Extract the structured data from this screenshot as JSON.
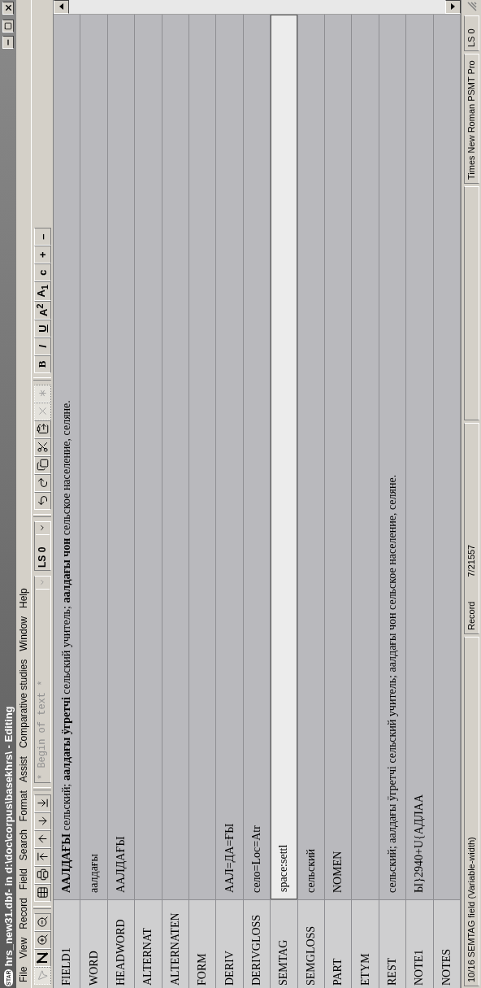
{
  "window": {
    "title": "hrs_new31.dbf- in d:\\doc\\corpus\\basekhrs\\ - Editing",
    "app_badge": "STAR"
  },
  "menu": [
    "File",
    "View",
    "Record",
    "Field",
    "Search",
    "Format",
    "Assist",
    "Comparative studies",
    "Window",
    "Help"
  ],
  "toolbar": {
    "nav_tools": [
      {
        "disabled": true
      },
      {
        "disabled": false
      },
      {
        "disabled": false
      },
      {
        "disabled": false
      },
      {
        "disabled": false
      },
      {
        "disabled": false
      },
      {
        "disabled": false
      },
      {
        "disabled": false
      },
      {
        "disabled": false
      },
      {
        "disabled": false
      }
    ],
    "position_combo": {
      "value": "* Begin of text *",
      "disabled": true
    },
    "language_combo": {
      "value": "LS 0"
    },
    "edit_tools": [
      {
        "disabled": false
      },
      {
        "disabled": false
      },
      {
        "disabled": false
      },
      {
        "disabled": false
      },
      {
        "disabled": false
      },
      {
        "disabled": true
      },
      {
        "disabled": true
      }
    ],
    "format_buttons": [
      {
        "label": "B",
        "kind": "bold"
      },
      {
        "label": "I",
        "kind": "italic"
      },
      {
        "label": "U",
        "kind": "underline"
      },
      {
        "label": "A$^{2}$",
        "kind": "plain"
      },
      {
        "label": "A$_{1}$",
        "kind": "plain"
      },
      {
        "label": "c",
        "kind": "plain"
      },
      {
        "label": "+",
        "kind": "plain"
      },
      {
        "label": "–",
        "kind": "plain"
      }
    ]
  },
  "rows": [
    {
      "label": "FIELD1",
      "value": "**ААЛДАҒЫ** сельский; **аалдағы ӱгретчі** сельский учитель; **аалдағы чон** сельское население, селяне.",
      "selected": false
    },
    {
      "label": "WORD",
      "value": "аалдағы",
      "selected": false
    },
    {
      "label": "HEADWORD",
      "value": "ААЛДАҒЫ",
      "selected": false
    },
    {
      "label": "ALTERNAT",
      "value": "",
      "selected": false
    },
    {
      "label": "ALTERNATEN",
      "value": "",
      "selected": false
    },
    {
      "label": "FORM",
      "value": "",
      "selected": false
    },
    {
      "label": "DERIV",
      "value": "ААЛ=ДА=ҒЫ",
      "selected": false
    },
    {
      "label": "DERIVGLOSS",
      "value": "село=Loc=Atr",
      "selected": false
    },
    {
      "label": "SEMTAG",
      "value": "space:settl",
      "selected": true
    },
    {
      "label": "SEMGLOSS",
      "value": "сельский",
      "selected": false
    },
    {
      "label": "PART",
      "value": "NOMEN",
      "selected": false
    },
    {
      "label": "ETYM",
      "value": "",
      "selected": false
    },
    {
      "label": "REST",
      "value": "сельский; аалдағы ӱгретчі сельский учитель; аалдағы чон сельское население, селяне.",
      "selected": false
    },
    {
      "label": "NOTE1",
      "value": "Ы}2940+U{АДЛАА",
      "selected": false
    },
    {
      "label": "NOTES",
      "value": "",
      "selected": false
    }
  ],
  "status_bar": {
    "field_info": "10/16 SEMTAG field (Variable-width)",
    "record_label": "Record",
    "record_value": "7/21557",
    "font": "Times New Roman PSMT Pro",
    "language": "LS 0"
  }
}
